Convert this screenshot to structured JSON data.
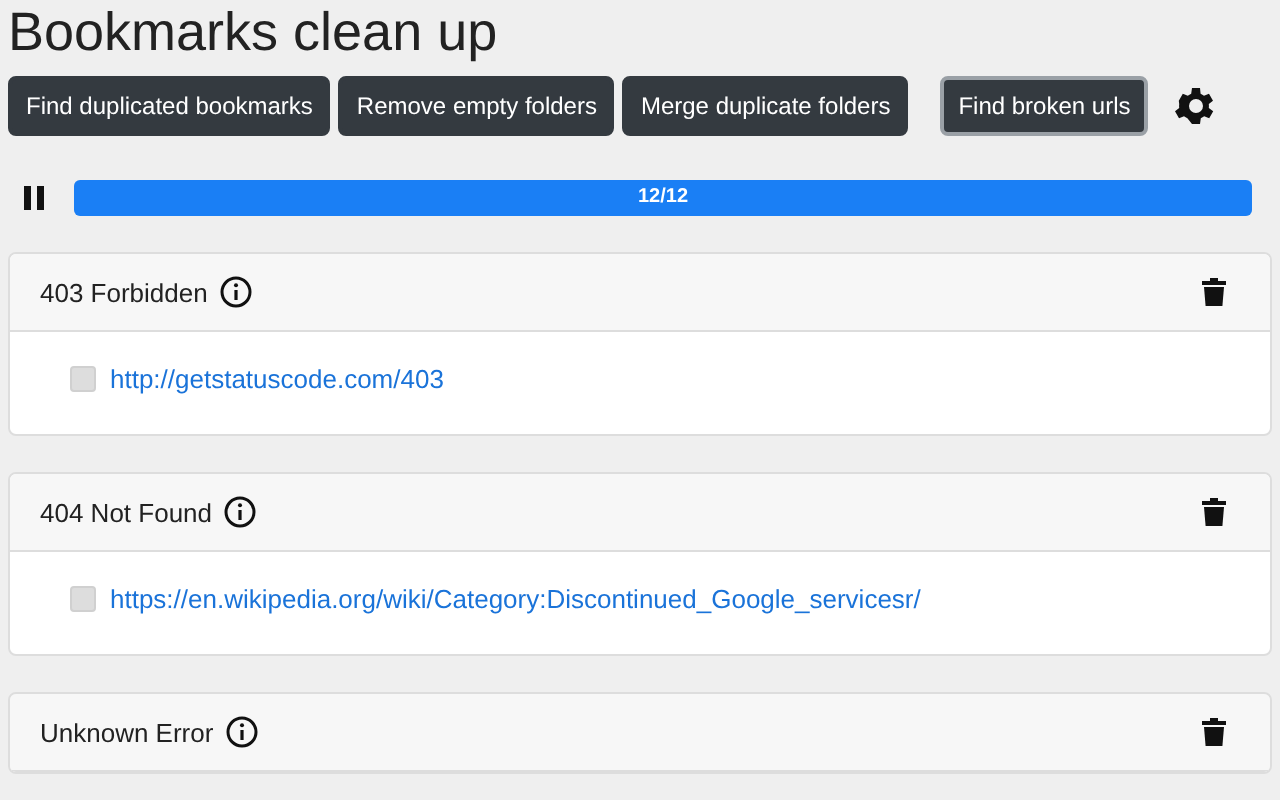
{
  "title": "Bookmarks clean up",
  "buttons": [
    {
      "label": "Find duplicated bookmarks",
      "selected": false
    },
    {
      "label": "Remove empty folders",
      "selected": false
    },
    {
      "label": "Merge duplicate folders",
      "selected": false
    },
    {
      "label": "Find broken urls",
      "selected": true
    }
  ],
  "progress": {
    "level": 1,
    "reading": "12/12"
  },
  "groups": [
    {
      "title": "403 Forbidden",
      "items": [
        {
          "url": "http://getstatuscode.com/403",
          "checked": false
        }
      ]
    },
    {
      "title": "404 Not Found",
      "items": [
        {
          "url": "https://en.wikipedia.org/wiki/Category:Discontinued_Google_servicesr/",
          "checked": false
        }
      ]
    },
    {
      "title": "Unknown Error"
    }
  ]
}
